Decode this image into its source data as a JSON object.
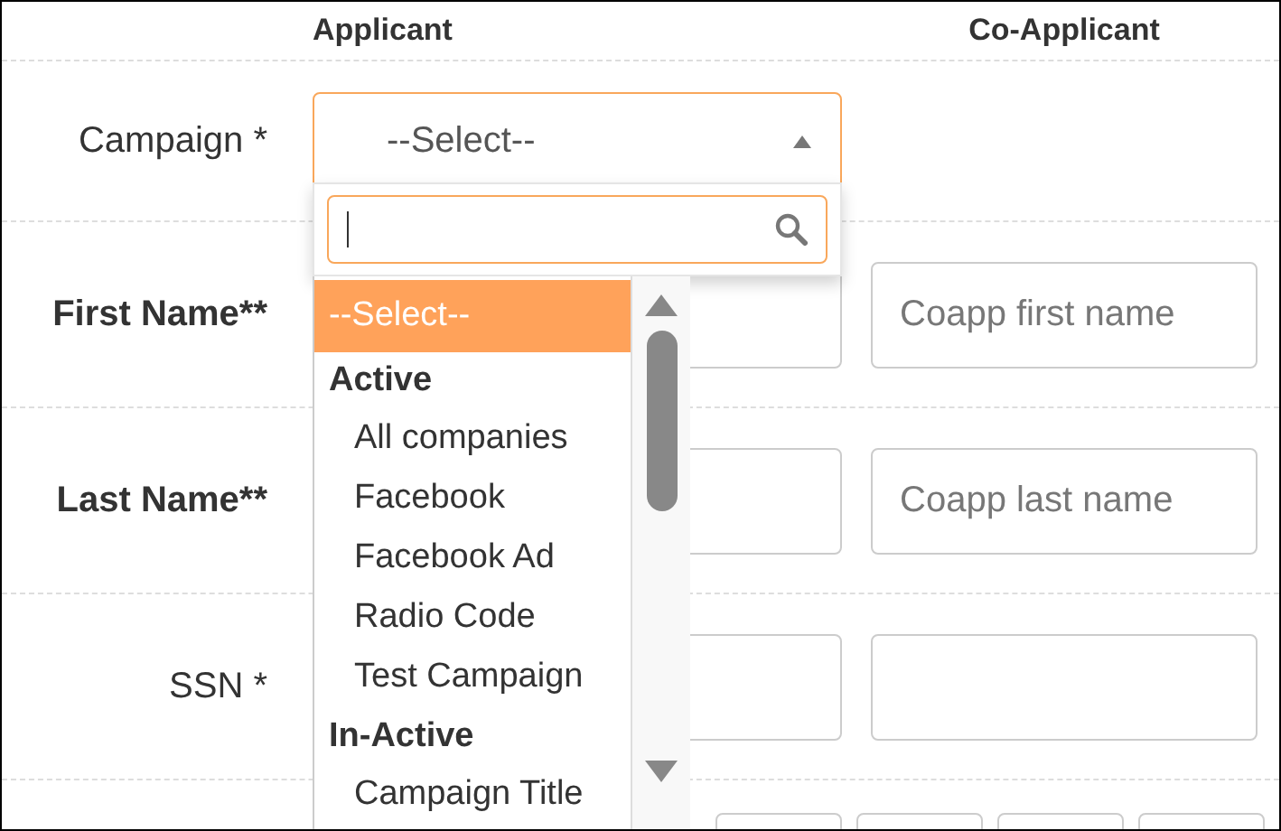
{
  "columns": [
    "Applicant",
    "Co-Applicant"
  ],
  "rows": [
    {
      "label": "Campaign *",
      "bold": false,
      "applicant": {
        "kind": "select",
        "value": "--Select--",
        "expanded": true
      }
    },
    {
      "label": "First Name**",
      "bold": true,
      "applicant": {
        "kind": "input"
      },
      "coapplicant": {
        "placeholder": "Coapp first name"
      }
    },
    {
      "label": "Last Name**",
      "bold": true,
      "applicant": {
        "kind": "input"
      },
      "coapplicant": {
        "placeholder": "Coapp last name"
      }
    },
    {
      "label": "SSN *",
      "bold": false,
      "applicant": {
        "kind": "input"
      },
      "coapplicant": {}
    }
  ],
  "dropdown": {
    "options": [
      {
        "kind": "option",
        "label": "--Select--",
        "selected": true
      },
      {
        "kind": "group",
        "label": "Active"
      },
      {
        "kind": "option",
        "label": "All companies",
        "selected": false
      },
      {
        "kind": "option",
        "label": "Facebook",
        "selected": false
      },
      {
        "kind": "option",
        "label": "Facebook Ad",
        "selected": false
      },
      {
        "kind": "option",
        "label": "Radio Code",
        "selected": false
      },
      {
        "kind": "option",
        "label": "Test Campaign",
        "selected": false
      },
      {
        "kind": "group",
        "label": "In-Active"
      },
      {
        "kind": "option",
        "label": "Campaign Title",
        "selected": false
      }
    ]
  }
}
